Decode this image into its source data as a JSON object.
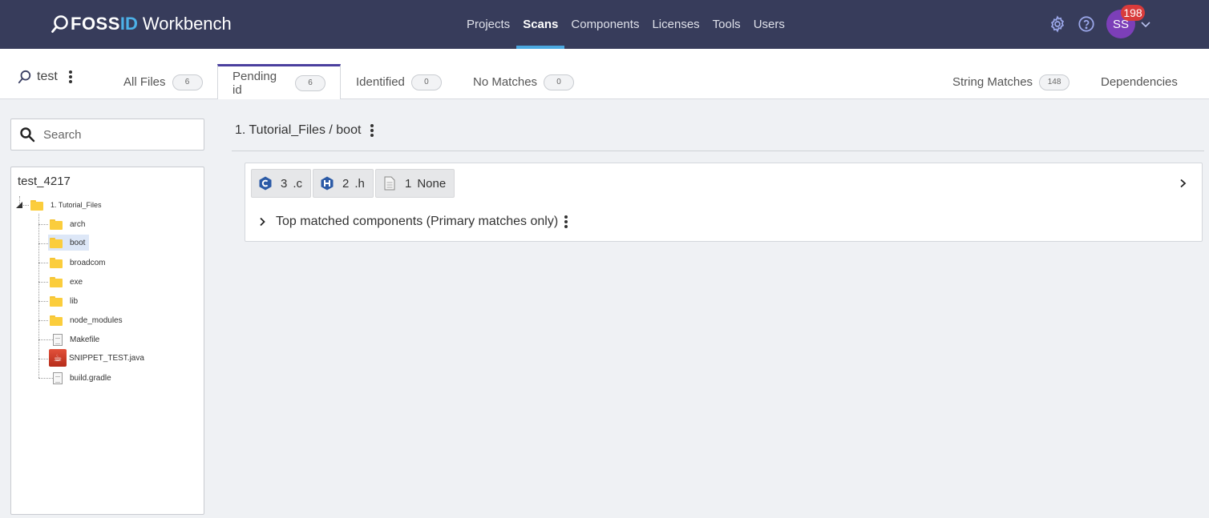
{
  "brand": {
    "foss": "FOSS",
    "id": "ID",
    "product": "Workbench"
  },
  "nav": {
    "items": [
      {
        "label": "Projects",
        "active": false
      },
      {
        "label": "Scans",
        "active": true
      },
      {
        "label": "Components",
        "active": false
      },
      {
        "label": "Licenses",
        "active": false
      },
      {
        "label": "Tools",
        "active": false
      },
      {
        "label": "Users",
        "active": false
      }
    ],
    "settings_icon": "gear-icon",
    "help_icon": "question-circle-icon",
    "user_initials": "SS",
    "notification_count": "198",
    "colors": {
      "navbar": "#373c5b",
      "accent": "#4ba8e0",
      "avatar": "#7c3fb8",
      "badge": "#d83b3b"
    }
  },
  "scan": {
    "name": "test"
  },
  "tabs": [
    {
      "label": "All Files",
      "count": "6",
      "active": false
    },
    {
      "label": "Pending id",
      "count": "6",
      "active": true
    },
    {
      "label": "Identified",
      "count": "0",
      "active": false
    },
    {
      "label": "No Matches",
      "count": "0",
      "active": false
    },
    {
      "label": "String Matches",
      "count": "148",
      "active": false
    },
    {
      "label": "Dependencies",
      "count": null,
      "active": false
    }
  ],
  "sidebar": {
    "search_placeholder": "Search",
    "tree": {
      "root": "test_4217",
      "folder": "1. Tutorial_Files",
      "children": [
        {
          "label": "arch",
          "type": "folder"
        },
        {
          "label": "boot",
          "type": "folder",
          "selected": true
        },
        {
          "label": "broadcom",
          "type": "folder"
        },
        {
          "label": "exe",
          "type": "folder"
        },
        {
          "label": "lib",
          "type": "folder"
        },
        {
          "label": "node_modules",
          "type": "folder"
        },
        {
          "label": "Makefile",
          "type": "file"
        },
        {
          "label": "SNIPPET_TEST.java",
          "type": "java"
        },
        {
          "label": "build.gradle",
          "type": "file"
        }
      ]
    }
  },
  "main": {
    "breadcrumb": "1. Tutorial_Files / boot",
    "extensions": [
      {
        "count": "3",
        "ext": ".c",
        "icon": "c-language-icon"
      },
      {
        "count": "2",
        "ext": ".h",
        "icon": "header-file-icon"
      },
      {
        "count": "1",
        "ext": "None",
        "icon": "document-icon"
      }
    ],
    "top_matched_label": "Top matched components (Primary matches only)"
  }
}
